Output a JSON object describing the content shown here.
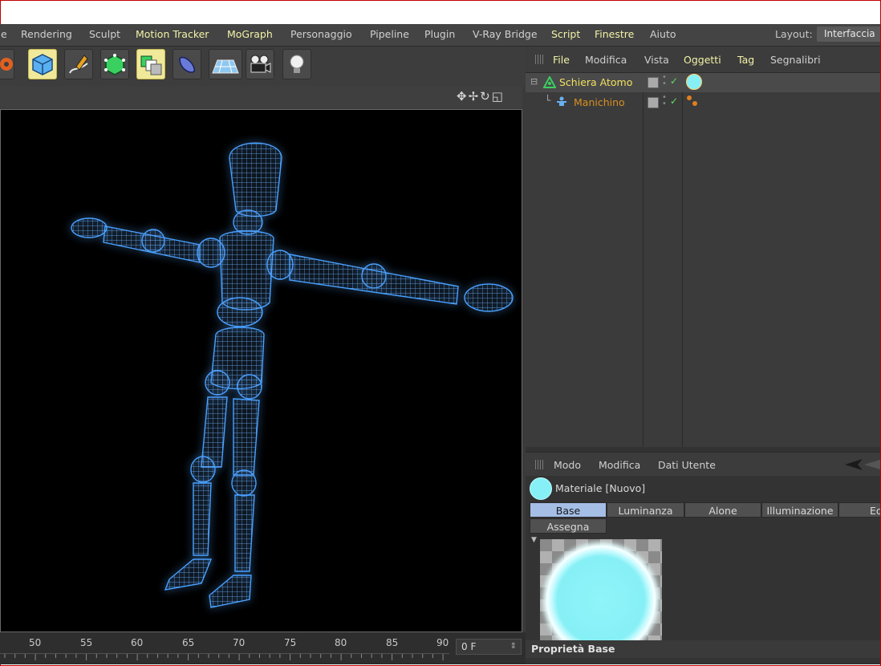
{
  "menubar": {
    "items": [
      {
        "label": "e",
        "hl": false
      },
      {
        "label": "Rendering",
        "hl": false
      },
      {
        "label": "Sculpt",
        "hl": false
      },
      {
        "label": "Motion Tracker",
        "hl": true
      },
      {
        "label": "MoGraph",
        "hl": true
      },
      {
        "label": "Personaggio",
        "hl": false
      },
      {
        "label": "Pipeline",
        "hl": false
      },
      {
        "label": "Plugin",
        "hl": false
      },
      {
        "label": "V-Ray Bridge",
        "hl": false
      },
      {
        "label": "Script",
        "hl": true
      },
      {
        "label": "Finestre",
        "hl": true
      },
      {
        "label": "Aiuto",
        "hl": false
      }
    ],
    "layout_label": "Layout:",
    "layout_value": "Interfaccia"
  },
  "toolbar": {
    "icons": [
      "render-settings-icon",
      "cube-icon",
      "pen-spline-icon",
      "subdivision-icon",
      "array-icon",
      "deformer-icon",
      "floor-icon",
      "camera-icon",
      "light-icon"
    ]
  },
  "viewport": {
    "nav_icons": "✥✢↻◱"
  },
  "timeline": {
    "ticks": [
      "50",
      "55",
      "60",
      "65",
      "70",
      "75",
      "80",
      "85",
      "90"
    ],
    "current_frame": "0 F"
  },
  "object_manager": {
    "menu": [
      {
        "label": "File",
        "hl": true
      },
      {
        "label": "Modifica",
        "hl": false
      },
      {
        "label": "Vista",
        "hl": false
      },
      {
        "label": "Oggetti",
        "hl": true
      },
      {
        "label": "Tag",
        "hl": true
      },
      {
        "label": "Segnalibri",
        "hl": false
      }
    ],
    "objects": [
      {
        "name": "Schiera Atomo",
        "color": "#f0e060",
        "icon": "atom-array-icon"
      },
      {
        "name": "Manichino",
        "color": "#e0a020",
        "icon": "figure-icon"
      }
    ]
  },
  "attribute_manager": {
    "menu": [
      "Modo",
      "Modifica",
      "Dati Utente"
    ],
    "title": "Materiale [Nuovo]",
    "tabs": [
      "Base",
      "Luminanza",
      "Alone",
      "Illuminazione",
      "Edit"
    ],
    "tabs_row2": [
      "Assegna"
    ],
    "section_title": "Proprietà Base"
  },
  "colors": {
    "wire": "#4aa0ff",
    "material": "#86f0f6",
    "active_tab": "#a4bee6"
  }
}
